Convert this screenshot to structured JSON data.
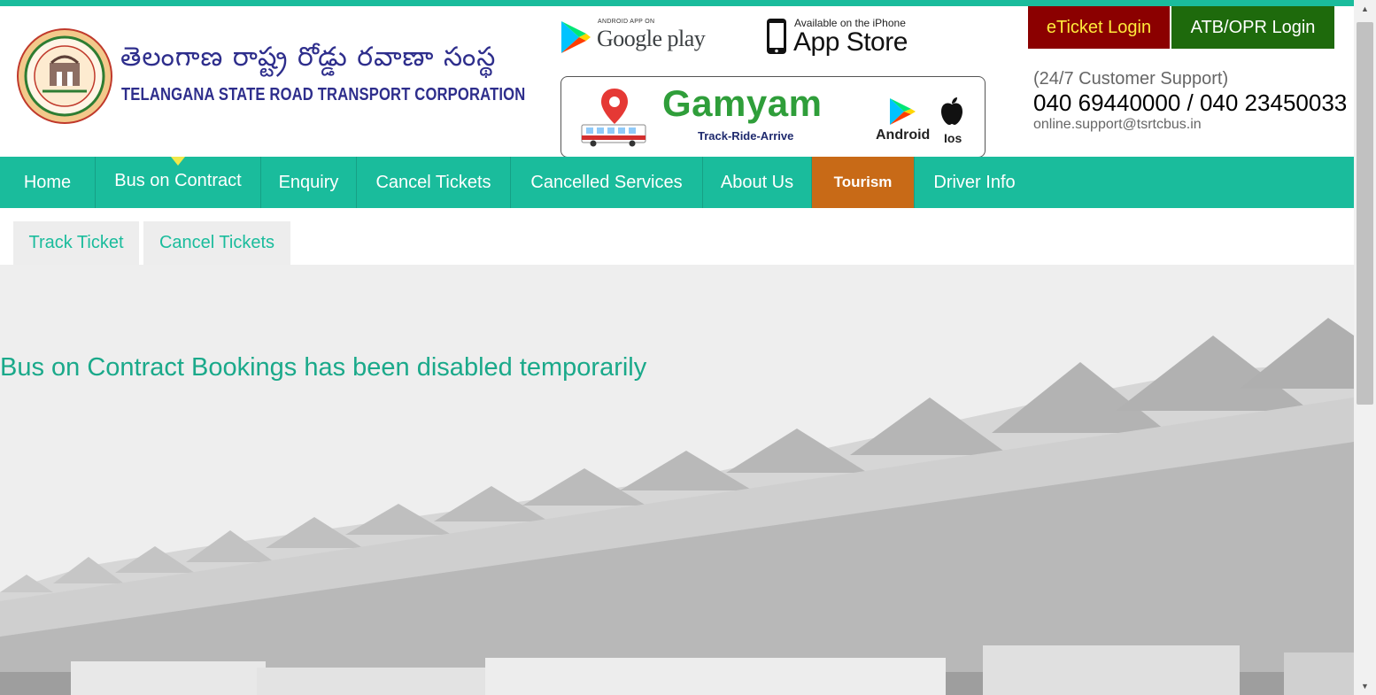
{
  "header": {
    "logo_icon": "tsrtc-emblem-icon",
    "title_telugu": "తెలంగాణ  రాష్ట్ర రోడ్డు రవాణా సంస్థ",
    "title_english": "TELANGANA STATE ROAD TRANSPORT CORPORATION"
  },
  "apps": {
    "google_play_small": "ANDROID APP ON",
    "google_play_big": "Google play",
    "app_store_small": "Available on the iPhone",
    "app_store_big": "App Store"
  },
  "gamyam": {
    "title": "Gamyam",
    "tagline": "Track-Ride-Arrive",
    "android_label": "Android",
    "ios_label": "Ios"
  },
  "login": {
    "eticket": "eTicket Login",
    "atb": "ATB/OPR Login"
  },
  "support": {
    "label": "(24/7 Customer Support)",
    "phone": "040 69440000 / 040 23450033",
    "email": "online.support@tsrtcbus.in"
  },
  "nav": {
    "home": "Home",
    "bus_on_contract": "Bus on Contract",
    "enquiry": "Enquiry",
    "cancel_tickets": "Cancel Tickets",
    "cancelled_services": "Cancelled Services",
    "about_us": "About Us",
    "tourism": "Tourism",
    "driver_info": "Driver Info"
  },
  "subtabs": {
    "track_ticket": "Track Ticket",
    "cancel_tickets": "Cancel Tickets"
  },
  "main": {
    "message": "Bus on Contract Bookings has been disabled temporarily"
  },
  "colors": {
    "accent": "#1abc9c",
    "tourism": "#c86a17",
    "eticket_bg": "#8b0000",
    "eticket_text": "#ffeb3b",
    "atb_bg": "#1e6a0c",
    "brand_blue": "#2e2e8c"
  }
}
